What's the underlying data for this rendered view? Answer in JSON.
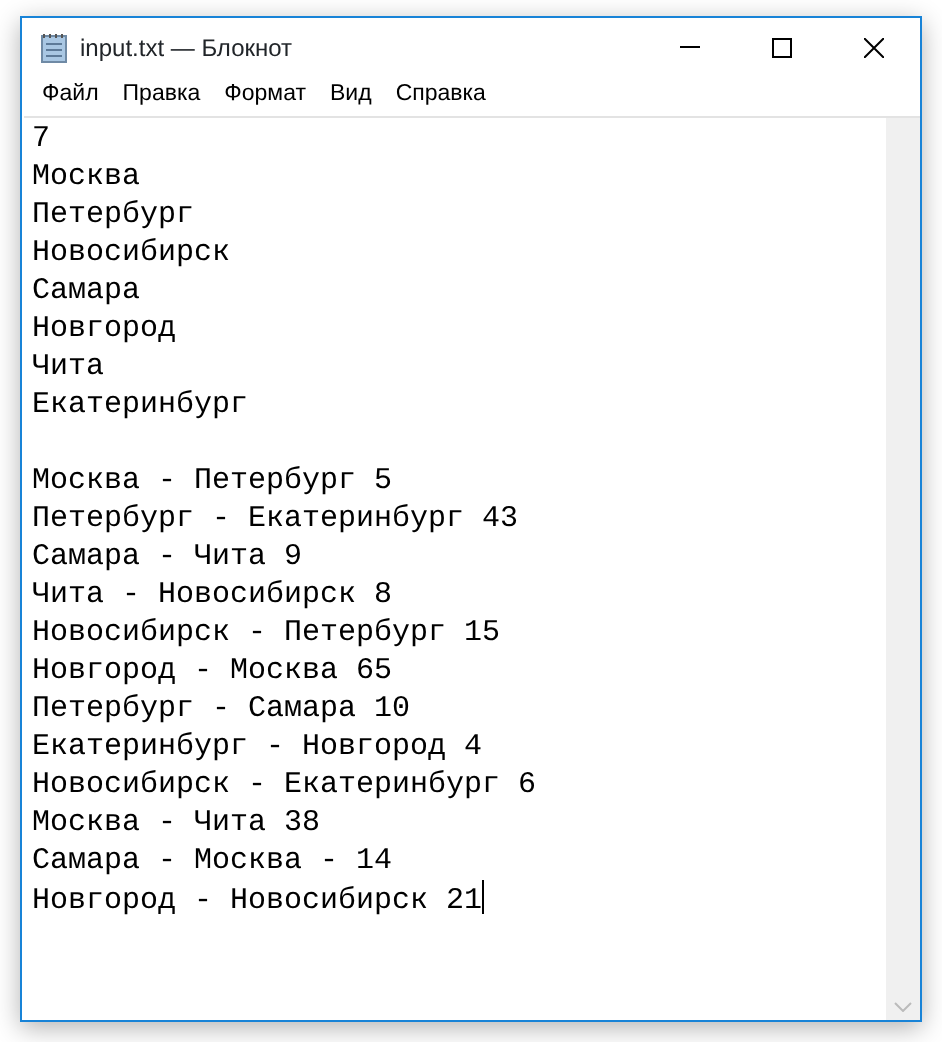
{
  "window": {
    "title": "input.txt — Блокнот"
  },
  "menu": [
    "Файл",
    "Правка",
    "Формат",
    "Вид",
    "Справка"
  ],
  "editor": {
    "count": "7",
    "cities": [
      "Москва",
      "Петербург",
      "Новосибирск",
      "Самара",
      "Новгород",
      "Чита",
      "Екатеринбург"
    ],
    "routes": [
      "Москва - Петербург 5",
      "Петербург - Екатеринбург 43",
      "Самара - Чита 9",
      "Чита - Новосибирск 8",
      "Новосибирск - Петербург 15",
      "Новгород - Москва 65",
      "Петербург - Самара 10",
      "Екатеринбург - Новгород 4",
      "Новосибирск - Екатеринбург 6",
      "Москва - Чита 38",
      "Самара - Москва - 14",
      "Новгород - Новосибирск 21"
    ],
    "caret_at_end": true
  }
}
